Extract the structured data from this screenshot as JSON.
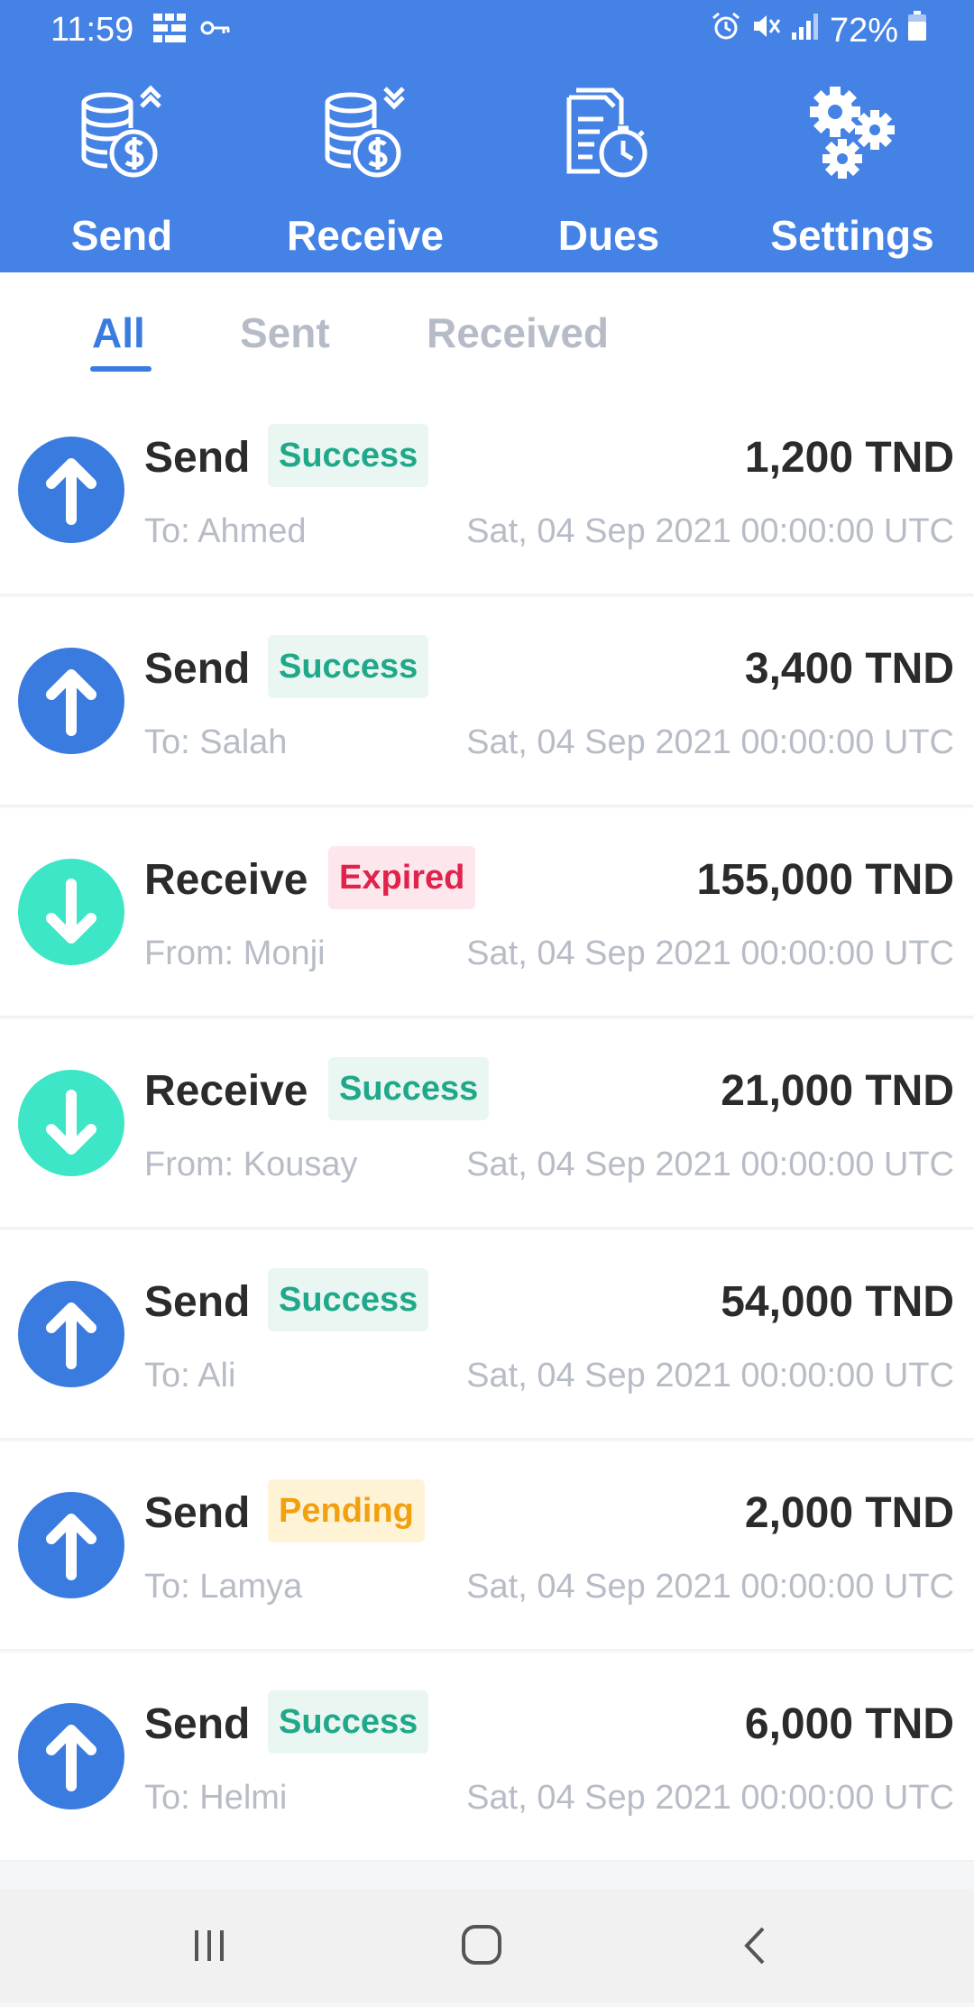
{
  "status_bar": {
    "time": "11:59",
    "battery": "72%",
    "left_icons": [
      "grid-app-icon",
      "key-icon"
    ],
    "right_icons": [
      "alarm-icon",
      "mute-icon",
      "signal-icon",
      "battery-icon"
    ]
  },
  "top_nav": {
    "items": [
      {
        "label": "Send",
        "icon": "coins-send-icon"
      },
      {
        "label": "Receive",
        "icon": "coins-receive-icon"
      },
      {
        "label": "Dues",
        "icon": "documents-timer-icon"
      },
      {
        "label": "Settings",
        "icon": "gears-icon"
      }
    ]
  },
  "tabs": {
    "items": [
      {
        "label": "All",
        "active": true
      },
      {
        "label": "Sent",
        "active": false
      },
      {
        "label": "Received",
        "active": false
      }
    ]
  },
  "transactions": [
    {
      "type": "Send",
      "status": "Success",
      "amount": "1,200 TND",
      "counterparty": "To: Ahmed",
      "date": "Sat, 04 Sep 2021 00:00:00 UTC"
    },
    {
      "type": "Send",
      "status": "Success",
      "amount": "3,400 TND",
      "counterparty": "To: Salah",
      "date": "Sat, 04 Sep 2021 00:00:00 UTC"
    },
    {
      "type": "Receive",
      "status": "Expired",
      "amount": "155,000 TND",
      "counterparty": "From: Monji",
      "date": "Sat, 04 Sep 2021 00:00:00 UTC"
    },
    {
      "type": "Receive",
      "status": "Success",
      "amount": "21,000 TND",
      "counterparty": "From: Kousay",
      "date": "Sat, 04 Sep 2021 00:00:00 UTC"
    },
    {
      "type": "Send",
      "status": "Success",
      "amount": "54,000 TND",
      "counterparty": "To: Ali",
      "date": "Sat, 04 Sep 2021 00:00:00 UTC"
    },
    {
      "type": "Send",
      "status": "Pending",
      "amount": "2,000 TND",
      "counterparty": "To: Lamya",
      "date": "Sat, 04 Sep 2021 00:00:00 UTC"
    },
    {
      "type": "Send",
      "status": "Success",
      "amount": "6,000 TND",
      "counterparty": "To: Helmi",
      "date": "Sat, 04 Sep 2021 00:00:00 UTC"
    }
  ],
  "colors": {
    "header_blue": "#4582e6",
    "send_circle": "#3a7be0",
    "receive_circle": "#3de6c6",
    "success_text": "#1fa88a",
    "success_bg": "#e9f6f1",
    "expired_text": "#e0234c",
    "expired_bg": "#fde7ec",
    "pending_text": "#f2a00f",
    "pending_bg": "#fff3d6"
  },
  "system_nav": {
    "items": [
      "recents-icon",
      "home-icon",
      "back-icon"
    ]
  }
}
